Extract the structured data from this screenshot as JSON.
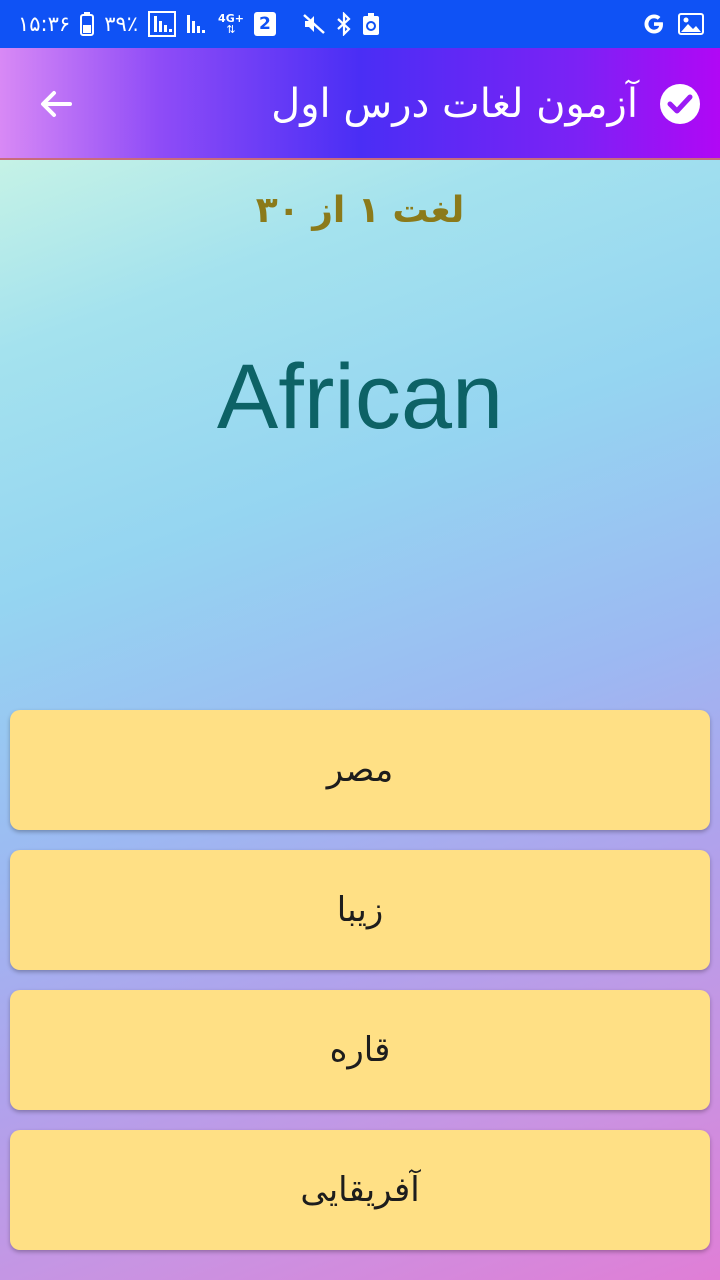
{
  "status_bar": {
    "time": "۱۵:۳۶",
    "battery_percent": "۳۹٪",
    "network_type": "4G+",
    "sim_slot": "2",
    "icons": [
      "battery-icon",
      "signal-icon",
      "signal-icon-2",
      "network-4g-icon",
      "sim-2-icon",
      "mute-icon",
      "bluetooth-icon",
      "recycle-icon",
      "google-icon",
      "gallery-icon"
    ]
  },
  "app_bar": {
    "title": "آزمون لغات درس اول",
    "back_icon": "arrow-left-icon",
    "check_icon": "check-circle-icon"
  },
  "quiz": {
    "progress": "لغت ۱ از ۳۰",
    "word": "African",
    "options": [
      "مصر",
      "زیبا",
      "قاره",
      "آفریقایی"
    ]
  },
  "colors": {
    "status_bar": "#0f52f5",
    "option_bg": "#ffe085",
    "progress_text": "#8b7a1a",
    "word_text": "#0d6266"
  }
}
